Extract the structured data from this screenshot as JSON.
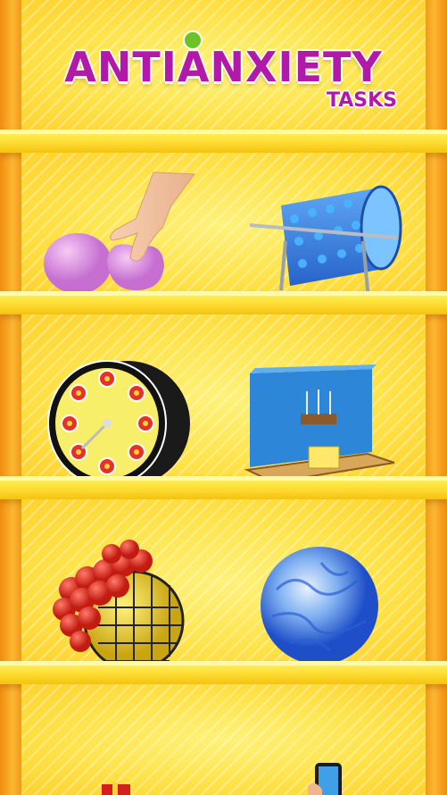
{
  "header": {
    "title": "ANTIANXIETY",
    "subtitle": "TASKS",
    "title_color": "#b11aa8",
    "accent_color": "#6cc326"
  },
  "shelves": [
    {
      "row": 1,
      "items": [
        {
          "name": "squeeze-slime-balls",
          "icon": "pink-squish-balls-icon"
        },
        {
          "name": "spiky-cylinder-roller",
          "icon": "spiky-roller-icon"
        }
      ]
    },
    {
      "row": 2,
      "items": [
        {
          "name": "dial-wheel-toy",
          "icon": "dial-wheel-icon"
        },
        {
          "name": "blue-box-machine",
          "icon": "blue-box-icon"
        }
      ]
    },
    {
      "row": 3,
      "items": [
        {
          "name": "mesh-stress-ball",
          "icon": "mesh-ball-icon"
        },
        {
          "name": "blue-marble-ball",
          "icon": "blue-ball-icon"
        }
      ]
    },
    {
      "row": 4,
      "items": [
        {
          "name": "red-gift-toy",
          "icon": "red-gift-icon"
        },
        {
          "name": "phone-toy",
          "icon": "phone-icon"
        }
      ]
    }
  ]
}
